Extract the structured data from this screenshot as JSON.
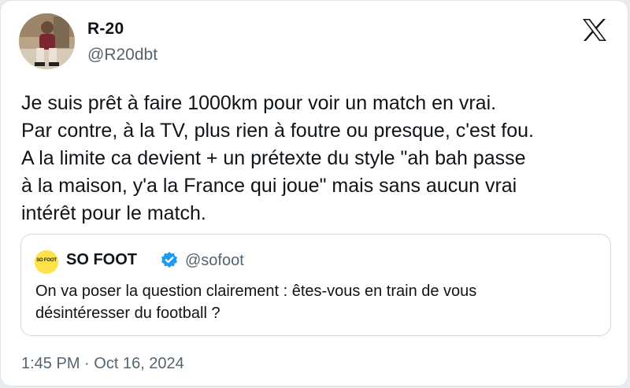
{
  "author": {
    "name": "R-20",
    "handle": "@R20dbt"
  },
  "tweet": {
    "lines": [
      "Je suis prêt à faire 1000km pour voir un match en vrai.",
      "Par contre, à la TV, plus rien à foutre ou presque, c'est fou.",
      "A la limite ca devient + un prétexte du style \"ah bah passe",
      "à la maison, y'a la France qui joue\" mais sans aucun vrai",
      "intérêt pour le match."
    ]
  },
  "quote": {
    "avatar_text": "SO FOOT",
    "name": "SO FOOT",
    "handle": "@sofoot",
    "lines": [
      "On va poser la question clairement : êtes-vous en train de vous",
      "désintéresser du football ?"
    ]
  },
  "meta": {
    "time": "1:45 PM",
    "separator": "·",
    "date": "Oct 16, 2024"
  },
  "icons": {
    "platform": "x-logo-icon",
    "verified": "verified-badge-icon"
  },
  "colors": {
    "text": "#0f1419",
    "secondary": "#536471",
    "verified": "#1d9bf0",
    "sofoot_yellow": "#ffe24a"
  }
}
